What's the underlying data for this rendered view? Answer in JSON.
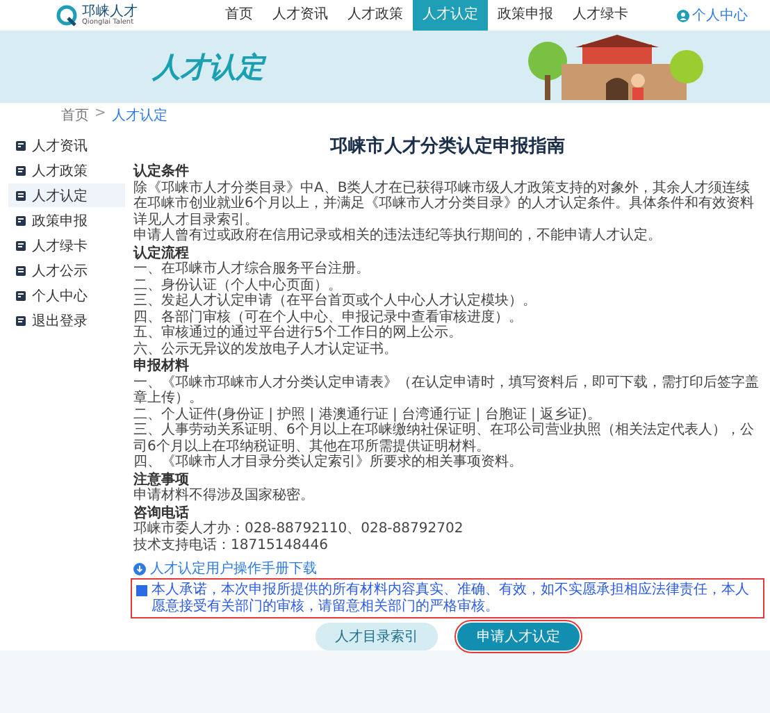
{
  "header": {
    "logo_title": "邛崃人才",
    "logo_subtitle": "Qionglai Talent",
    "nav": [
      {
        "label": "首页",
        "selected": false
      },
      {
        "label": "人才资讯",
        "selected": false
      },
      {
        "label": "人才政策",
        "selected": false
      },
      {
        "label": "人才认定",
        "selected": true
      },
      {
        "label": "政策申报",
        "selected": false
      },
      {
        "label": "人才绿卡",
        "selected": false
      }
    ],
    "user_link": "个人中心"
  },
  "banner": {
    "title": "人才认定"
  },
  "breadcrumb": {
    "home": "首页",
    "separator": ">",
    "current": "人才认定"
  },
  "sidebar": {
    "items": [
      {
        "label": "人才资讯",
        "selected": false
      },
      {
        "label": "人才政策",
        "selected": false
      },
      {
        "label": "人才认定",
        "selected": true
      },
      {
        "label": "政策申报",
        "selected": false
      },
      {
        "label": "人才绿卡",
        "selected": false
      },
      {
        "label": "人才公示",
        "selected": false
      },
      {
        "label": "个人中心",
        "selected": false
      },
      {
        "label": "退出登录",
        "selected": false
      }
    ]
  },
  "article": {
    "title": "邛崃市人才分类认定申报指南",
    "blocks": [
      {
        "kind": "heading",
        "text": "认定条件"
      },
      {
        "kind": "paragraph",
        "text": "除《邛崃市人才分类目录》中A、B类人才在已获得邛崃市级人才政策支持的对象外，其余人才须连续在邛崃市创业就业6个月以上，并满足《邛崃市人才分类目录》的人才认定条件。具体条件和有效资料详见人才目录索引。"
      },
      {
        "kind": "paragraph",
        "text": "申请人曾有过或政府在信用记录或相关的违法违纪等执行期间的，不能申请人才认定。"
      },
      {
        "kind": "heading",
        "text": "认定流程"
      },
      {
        "kind": "paragraph",
        "text": "一、在邛崃市人才综合服务平台注册。"
      },
      {
        "kind": "paragraph",
        "text": "二、身份认证（个人中心页面）。"
      },
      {
        "kind": "paragraph",
        "text": "三、发起人才认定申请（在平台首页或个人中心人才认定模块）。"
      },
      {
        "kind": "paragraph",
        "text": "四、各部门审核（可在个人中心、申报记录中查看审核进度）。"
      },
      {
        "kind": "paragraph",
        "text": "五、审核通过的通过平台进行5个工作日的网上公示。"
      },
      {
        "kind": "paragraph",
        "text": "六、公示无异议的发放电子人才认定证书。"
      },
      {
        "kind": "heading",
        "text": "申报材料"
      },
      {
        "kind": "paragraph",
        "text": "一、《邛崃市邛崃市人才分类认定申请表》（在认定申请时，填写资料后，即可下载，需打印后签字盖章上传）。"
      },
      {
        "kind": "paragraph",
        "text": "二、个人证件(身份证 | 护照 | 港澳通行证 | 台湾通行证 | 台胞证 | 返乡证)。"
      },
      {
        "kind": "paragraph",
        "text": "三、人事劳动关系证明、6个月以上在邛崃缴纳社保证明、在邛公司营业执照（相关法定代表人），公司6个月以上在邛纳税证明、其他在邛所需提供证明材料。"
      },
      {
        "kind": "paragraph",
        "text": "四、《邛崃市人才目录分类认定索引》所要求的相关事项资料。"
      },
      {
        "kind": "heading",
        "text": "注意事项"
      },
      {
        "kind": "paragraph",
        "text": "申请材料不得涉及国家秘密。"
      },
      {
        "kind": "heading",
        "text": "咨询电话"
      },
      {
        "kind": "paragraph",
        "text": "邛崃市委人才办：028-88792110、028-88792702"
      },
      {
        "kind": "paragraph",
        "text": "技术支持电话：18715148446"
      }
    ],
    "download_link": "人才认定用户操作手册下载",
    "agreement": {
      "text": "本人承诺，本次申报所提供的所有材料内容真实、准确、有效，如不实愿承担相应法律责任，本人愿意接受有关部门的审核，请留意相关部门的严格审核。",
      "checked": true,
      "highlighted": true
    },
    "buttons": [
      {
        "label": "人才目录索引",
        "kind": "secondary",
        "highlighted": false
      },
      {
        "label": "申请人才认定",
        "kind": "primary",
        "highlighted": true
      }
    ]
  }
}
